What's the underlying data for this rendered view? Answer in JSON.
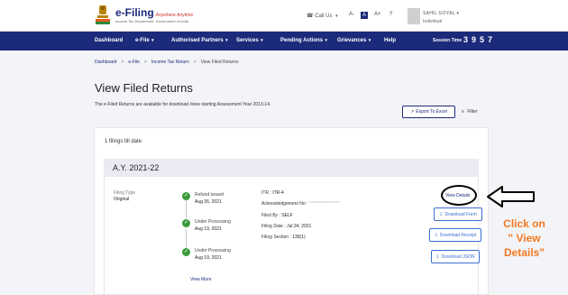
{
  "header": {
    "logo_title": "e-Filing",
    "logo_tag": "Anywhere Anytime",
    "logo_sub": "Income Tax Department, Government of India",
    "call_us": "Call Us",
    "font_small": "A-",
    "font_normal": "A",
    "font_large": "A+",
    "help_icon": "?",
    "user_name": "SAHIL GOYAL",
    "user_type": "Individual"
  },
  "nav": {
    "items": [
      "Dashboard",
      "e-File",
      "Authorised Partners",
      "Services",
      "Pending Actions",
      "Grievances",
      "Help"
    ],
    "session_label": "Session Time",
    "timer": [
      "3",
      "9",
      "5",
      "7"
    ]
  },
  "breadcrumb": [
    "Dashboard",
    "e-File",
    "Income Tax Return",
    "View Filed Returns"
  ],
  "page": {
    "title": "View Filed Returns",
    "description": "The e-Filed Returns are available for download /view starting Assessment Year 2013-14.",
    "export_label": "Export To Excel",
    "filter_label": "Filter"
  },
  "card": {
    "count_text": "1 filings till date",
    "ay": "A.Y. 2021-22",
    "filing_type_label": "Filing Type",
    "filing_type_value": "Original",
    "statuses": [
      {
        "status": "Refund issued",
        "date": "Aug 26, 2021"
      },
      {
        "status": "Under Processing",
        "date": "Aug 19, 2021"
      },
      {
        "status": "Under Processing",
        "date": "Aug 19, 2021"
      }
    ],
    "view_more": "View More",
    "itr_label": "ITR :",
    "itr_value": "ITR-4",
    "ack_label": "Acknowledgement No :",
    "ack_value": "**************",
    "filed_by_label": "Filed By :",
    "filed_by_value": "SELF",
    "filing_date_label": "Filing Date :",
    "filing_date_value": "Jul 24, 2021",
    "filing_section_label": "Filing Section :",
    "filing_section_value": "139(1)",
    "view_details": "View Details",
    "download_form": "Download Form",
    "download_receipt": "Download Receipt",
    "download_json": "Download JSON"
  },
  "annotation": {
    "line1": "Click on",
    "line2": "\" View",
    "line3": "Details\"",
    "color": "#f47920"
  }
}
